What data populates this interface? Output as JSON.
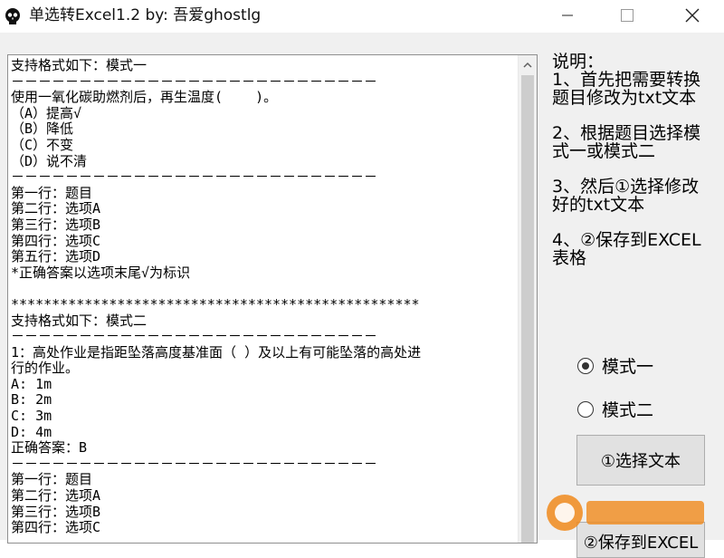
{
  "window": {
    "title": "单选转Excel1.2 by: 吾爱ghostlg"
  },
  "textarea": {
    "lines": [
      "支持格式如下：模式一",
      "－－－－－－－－－－－－－－－－－－－－－－－－－－－",
      "使用一氧化碳助燃剂后，再生温度(    )。",
      "（A）提高√",
      "（B）降低",
      "（C）不变",
      "（D）说不清",
      "－－－－－－－－－－－－－－－－－－－－－－－－－－－",
      "第一行：题目",
      "第二行：选项A",
      "第三行：选项B",
      "第四行：选项C",
      "第五行：选项D",
      "*正确答案以选项末尾√为标识",
      "",
      "**************************************************",
      "支持格式如下：模式二",
      "－－－－－－－－－－－－－－－－－－－－－－－－－－－",
      "1：高处作业是指距坠落高度基准面（ ）及以上有可能坠落的高处进",
      "行的作业。",
      "A: 1m",
      "B: 2m",
      "C: 3m",
      "D: 4m",
      "正确答案：B",
      "－－－－－－－－－－－－－－－－－－－－－－－－－－－",
      "第一行：题目",
      "第二行：选项A",
      "第三行：选项B",
      "第四行：选项C"
    ]
  },
  "instructions": {
    "title": "说明：",
    "steps": [
      "1、首先把需要转换题目修改为txt文本",
      "2、根据题目选择模式一或模式二",
      "3、然后①选择修改好的txt文本",
      "4、②保存到EXCEL表格"
    ]
  },
  "modes": {
    "mode1_label": "模式一",
    "mode2_label": "模式二",
    "selected": "模式一"
  },
  "buttons": {
    "select_text": "①选择文本",
    "save_excel": "②保存到EXCEL"
  },
  "colors": {
    "client_bg": "#f0f0f0",
    "button_bg": "#e1e1e1",
    "watermark_orange": "#f08a1c"
  },
  "icons": {
    "app": "skull-icon",
    "scroll_up": "scroll-up-arrow-icon"
  }
}
